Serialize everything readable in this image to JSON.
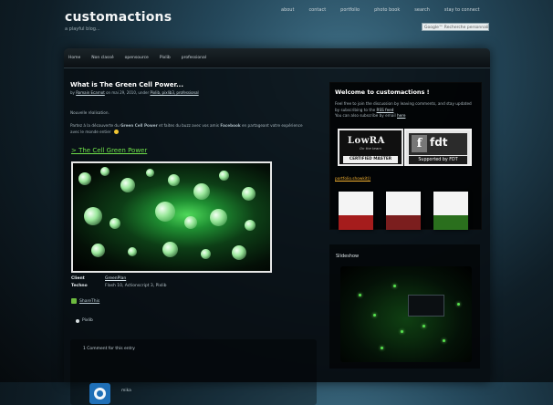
{
  "site": {
    "title": "customactions",
    "tagline": "a playful blog..."
  },
  "top_nav": {
    "items": [
      "about",
      "contact",
      "portfolio",
      "photo book",
      "search",
      "stay to connect"
    ]
  },
  "search": {
    "placeholder": "Google™ Recherche personnalisée"
  },
  "main_menu": {
    "items": [
      "Home",
      "Non classé",
      "opensource",
      "Pixlib",
      "professional"
    ]
  },
  "post": {
    "title": "What is The Green Cell Power...",
    "meta_prefix": "by",
    "meta_author": "Romain Ecarnot",
    "meta_middle": "on mai 29, 2010, under",
    "meta_tags": "Pixlib, pixlib3, professional",
    "p1": "Nouvelle réalisation.",
    "p2_pre": "Partez à la découverte du",
    "p2_bold1": "Green Cell Power",
    "p2_mid": "et faites du buzz avec vos amis",
    "p2_bold2": "Facebook",
    "p2_post": "en partageant votre expérience avec le monde entier",
    "subhead": "> The Cell Green Power",
    "info": [
      {
        "key": "Client",
        "value": "GreenPlan"
      },
      {
        "key": "Techno",
        "value": "Flash 10, Actionscript 3, Pixlib"
      }
    ],
    "share_label": "ShareThis",
    "tag_label": "Pixlib"
  },
  "comments": {
    "header": "1 Comment for this entry",
    "author": "mika"
  },
  "sidebar": {
    "welcome_title": "Welcome to customactions !",
    "welcome_text_1": "Feel free to join the discussion by leaving comments, and stay updated by subscribing to the",
    "welcome_link_rss": "RSS feed",
    "welcome_text_2": "You can also subscribe by email",
    "welcome_link_here": "here",
    "lowra": {
      "big": "LowRA",
      "sub": "On the team",
      "cert": "CERTIFIED MASTER"
    },
    "fdt": {
      "logo": "fdt",
      "caption": "Supported by FDT"
    },
    "portfolio_link": "portfolio.showkit()",
    "slideshow_title": "Slideshow"
  },
  "colors": {
    "accent_green": "#6fe04a",
    "link_orange": "#f3b130",
    "background_dark": "#0b1014"
  }
}
